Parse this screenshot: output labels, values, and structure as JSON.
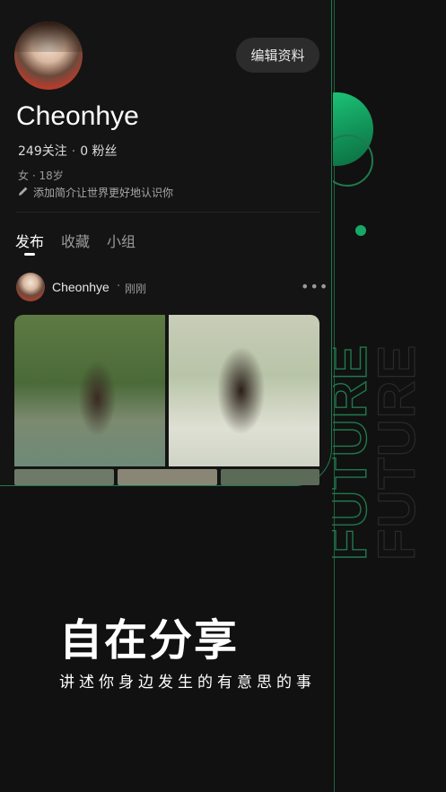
{
  "profile": {
    "edit_label": "编辑资料",
    "name": "Cheonhye",
    "following": "249关注",
    "followers": "0 粉丝",
    "gender_age": "女 · 18岁",
    "bio_placeholder": "添加简介让世界更好地认识你"
  },
  "tabs": [
    {
      "label": "发布",
      "active": true
    },
    {
      "label": "收藏",
      "active": false
    },
    {
      "label": "小组",
      "active": false
    }
  ],
  "post": {
    "author": "Cheonhye",
    "time": "刚刚",
    "more_icon": "more-icon"
  },
  "promo": {
    "headline": "自在分享",
    "subline": "讲述你身边发生的有意思的事"
  },
  "decor": {
    "watermark_text": "FUTURE"
  },
  "colors": {
    "background": "#111111",
    "accent": "#1ecf7e"
  }
}
